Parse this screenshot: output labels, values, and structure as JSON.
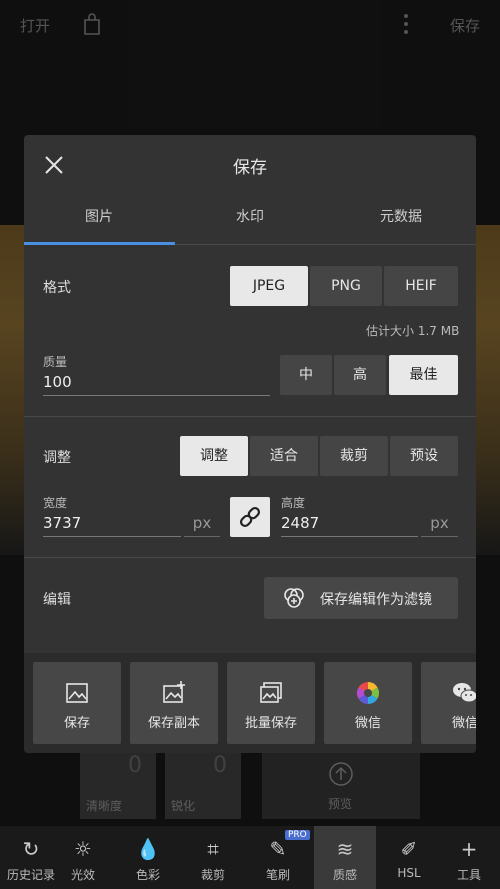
{
  "topbar": {
    "open": "打开",
    "save": "保存",
    "more_icon": "more-vertical-icon",
    "share_icon": "share-icon"
  },
  "background_tiles": {
    "sharpness": "清晰度",
    "sharpen": "锐化",
    "preview": "预览",
    "zero": "0"
  },
  "bottom_tools": [
    {
      "label": "历史记录",
      "icon": "history-icon"
    },
    {
      "label": "光效",
      "icon": "brightness-icon"
    },
    {
      "label": "色彩",
      "icon": "color-drop-icon"
    },
    {
      "label": "裁剪",
      "icon": "crop-icon"
    },
    {
      "label": "笔刷",
      "icon": "brush-icon",
      "badge": "PRO"
    },
    {
      "label": "质感",
      "icon": "texture-icon"
    },
    {
      "label": "HSL",
      "icon": "hsl-icon"
    },
    {
      "label": "工具",
      "icon": "plus-icon"
    }
  ],
  "dialog": {
    "title": "保存",
    "tabs": [
      "图片",
      "水印",
      "元数据"
    ],
    "format": {
      "label": "格式",
      "options": [
        "JPEG",
        "PNG",
        "HEIF"
      ],
      "selected": "JPEG"
    },
    "estimate": "估计大小 1.7 MB",
    "quality": {
      "label": "质量",
      "value": "100",
      "options": [
        "中",
        "高",
        "最佳"
      ],
      "selected": "最佳"
    },
    "adjust": {
      "label": "调整",
      "options": [
        "调整",
        "适合",
        "裁剪",
        "预设"
      ],
      "selected": "调整"
    },
    "width": {
      "label": "宽度",
      "value": "3737",
      "unit": "px"
    },
    "height": {
      "label": "高度",
      "value": "2487",
      "unit": "px"
    },
    "edit": {
      "label": "编辑",
      "button": "保存编辑作为滤镜"
    },
    "share": [
      {
        "label": "保存",
        "icon": "image-icon"
      },
      {
        "label": "保存副本",
        "icon": "image-add-icon"
      },
      {
        "label": "批量保存",
        "icon": "images-icon"
      },
      {
        "label": "微信",
        "icon": "aperture-icon"
      },
      {
        "label": "微信",
        "icon": "wechat-icon"
      }
    ]
  }
}
